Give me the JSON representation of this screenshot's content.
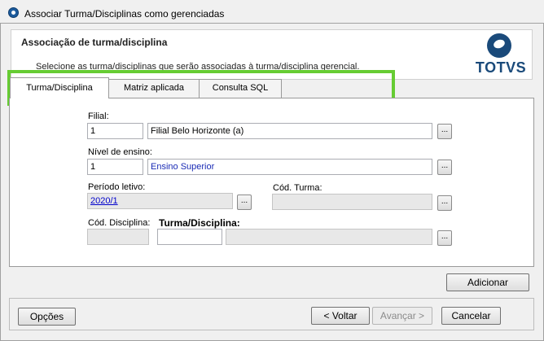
{
  "window": {
    "title": "Associar Turma/Disciplinas como gerenciadas"
  },
  "header": {
    "title": "Associação de turma/disciplina",
    "subtitle": "Selecione as turma/disciplinas que serão associadas à turma/disciplina gerencial.",
    "logo_text": "TOTVS"
  },
  "tabs": [
    {
      "label": "Turma/Disciplina",
      "active": true
    },
    {
      "label": "Matriz aplicada",
      "active": false
    },
    {
      "label": "Consulta SQL",
      "active": false
    }
  ],
  "form": {
    "filial": {
      "label": "Filial:",
      "code": "1",
      "name": "Filial Belo Horizonte (a)"
    },
    "nivel": {
      "label": "Nível de ensino:",
      "code": "1",
      "name": "Ensino Superior"
    },
    "periodo": {
      "label": "Período letivo:",
      "value": "2020/1"
    },
    "cod_turma": {
      "label": "Cód. Turma:",
      "value": ""
    },
    "cod_disciplina": {
      "label": "Cód. Disciplina:",
      "value": ""
    },
    "turma_disciplina": {
      "label": "Turma/Disciplina:",
      "code": "",
      "name": ""
    },
    "ellipsis_label": "..."
  },
  "buttons": {
    "adicionar": "Adicionar",
    "opcoes": "Opções",
    "voltar": "< Voltar",
    "avancar": "Avançar >",
    "cancelar": "Cancelar"
  },
  "colors": {
    "highlight": "#66cc33",
    "brand": "#1a4a7a",
    "link": "#0000cc"
  }
}
